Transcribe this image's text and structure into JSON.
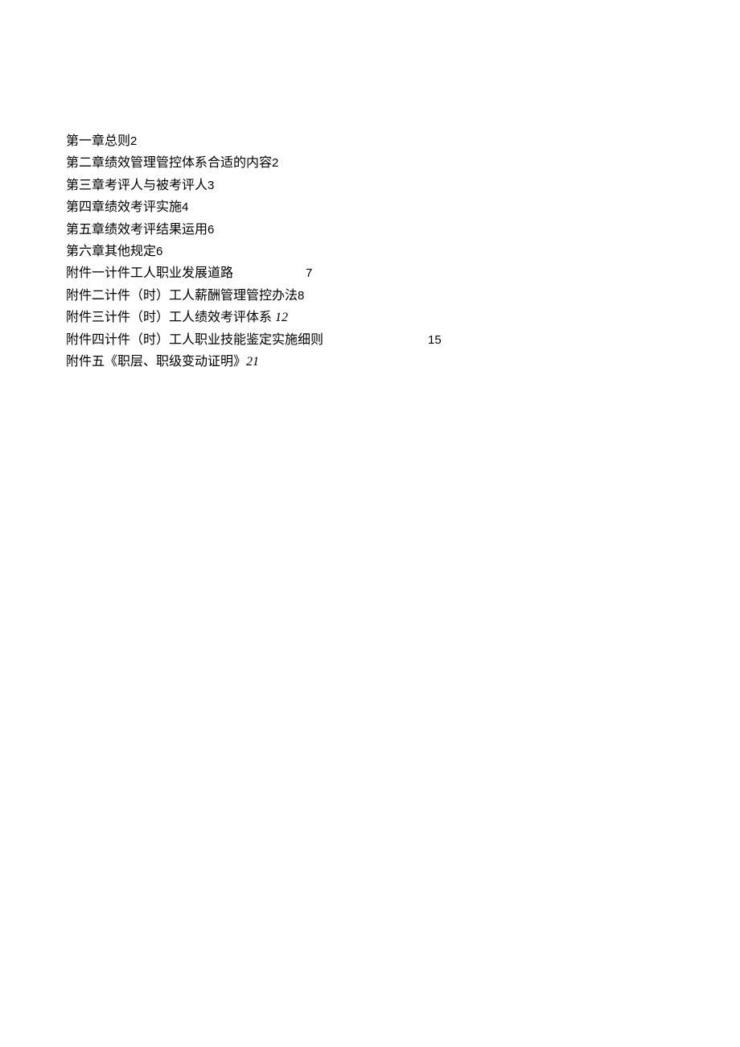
{
  "toc": [
    {
      "label": "第一章总则",
      "page": "2",
      "page_class": "sans",
      "gap_class": "gap-small"
    },
    {
      "label": "第二章绩效管理管控体系合适的内容",
      "page": "2",
      "page_class": "sans",
      "gap_class": "gap-small"
    },
    {
      "label": "第三章考评人与被考评人",
      "page": "3",
      "page_class": "sans",
      "gap_class": "gap-small"
    },
    {
      "label": "第四章绩效考评实施",
      "page": "4",
      "page_class": "sans",
      "gap_class": "gap-small"
    },
    {
      "label": "第五章绩效考评结果运用",
      "page": "6",
      "page_class": "sans",
      "gap_class": "gap-small"
    },
    {
      "label": "第六章其他规定",
      "page": "6",
      "page_class": "sans",
      "gap_class": "gap-small"
    },
    {
      "label": "附件一计件工人职业发展道路",
      "page": "7",
      "page_class": "sans",
      "gap_class": "gap-wide1"
    },
    {
      "label": "附件二计件（时）工人薪酬管理管控办法",
      "page": "8",
      "page_class": "sans",
      "gap_class": "gap-small"
    },
    {
      "label": "附件三计件（时）工人绩效考评体系",
      "page": "12",
      "page_class": "italic",
      "gap_class": "gap-small"
    },
    {
      "label": "附件四计件（时）工人职业技能鉴定实施细则",
      "page": "15",
      "page_class": "sans",
      "gap_class": "gap-wide2"
    },
    {
      "label": "附件五《职层、职级变动证明》",
      "page": "21",
      "page_class": "italic",
      "gap_class": "gap-small"
    }
  ]
}
